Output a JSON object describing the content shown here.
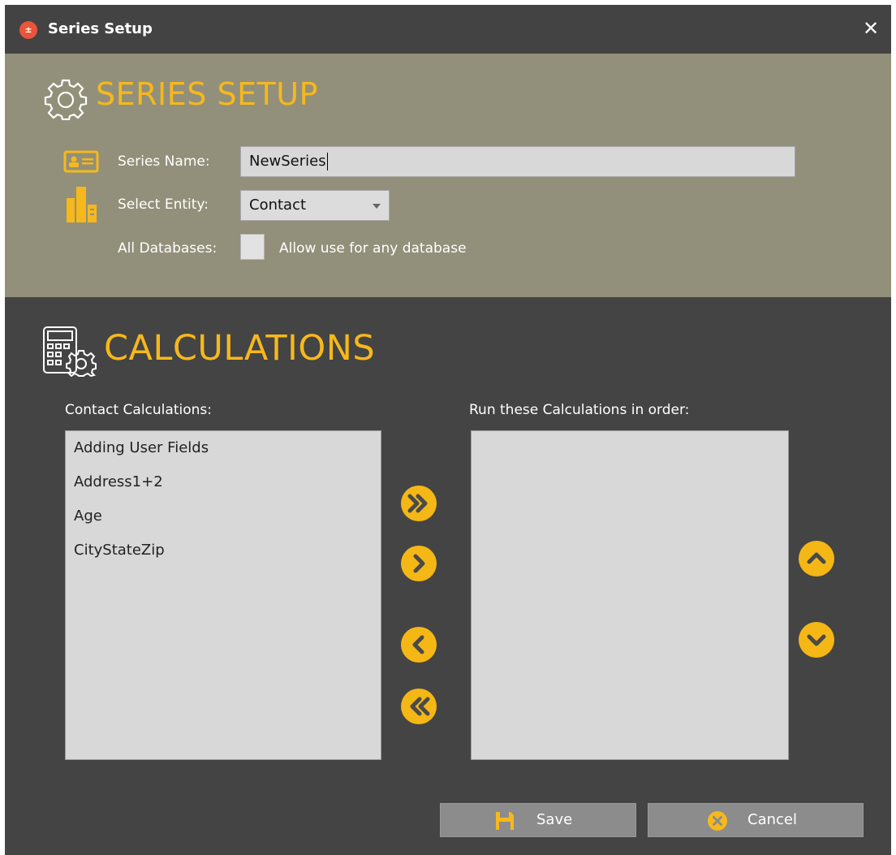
{
  "window": {
    "title": "Series Setup",
    "app_icon": "calculator-icon",
    "close_glyph": "✕"
  },
  "setup": {
    "heading": "SERIES SETUP",
    "series_name_label": "Series Name:",
    "series_name_value": "NewSeries",
    "select_entity_label": "Select Entity:",
    "select_entity_value": "Contact",
    "all_databases_label": "All Databases:",
    "all_databases_checked": false,
    "all_databases_text": "Allow use for any database"
  },
  "calculations": {
    "heading": "CALCULATIONS",
    "available_label": "Contact Calculations:",
    "available_items": [
      "Adding User Fields",
      "Address1+2",
      "Age",
      "CityStateZip"
    ],
    "selected_label": "Run these Calculations in order:",
    "selected_items": []
  },
  "buttons": {
    "save": "Save",
    "cancel": "Cancel"
  },
  "colors": {
    "accent": "#f7b81c",
    "setup_panel": "#92907a",
    "window_bg": "#444444",
    "list_bg": "#d8d8d8"
  }
}
